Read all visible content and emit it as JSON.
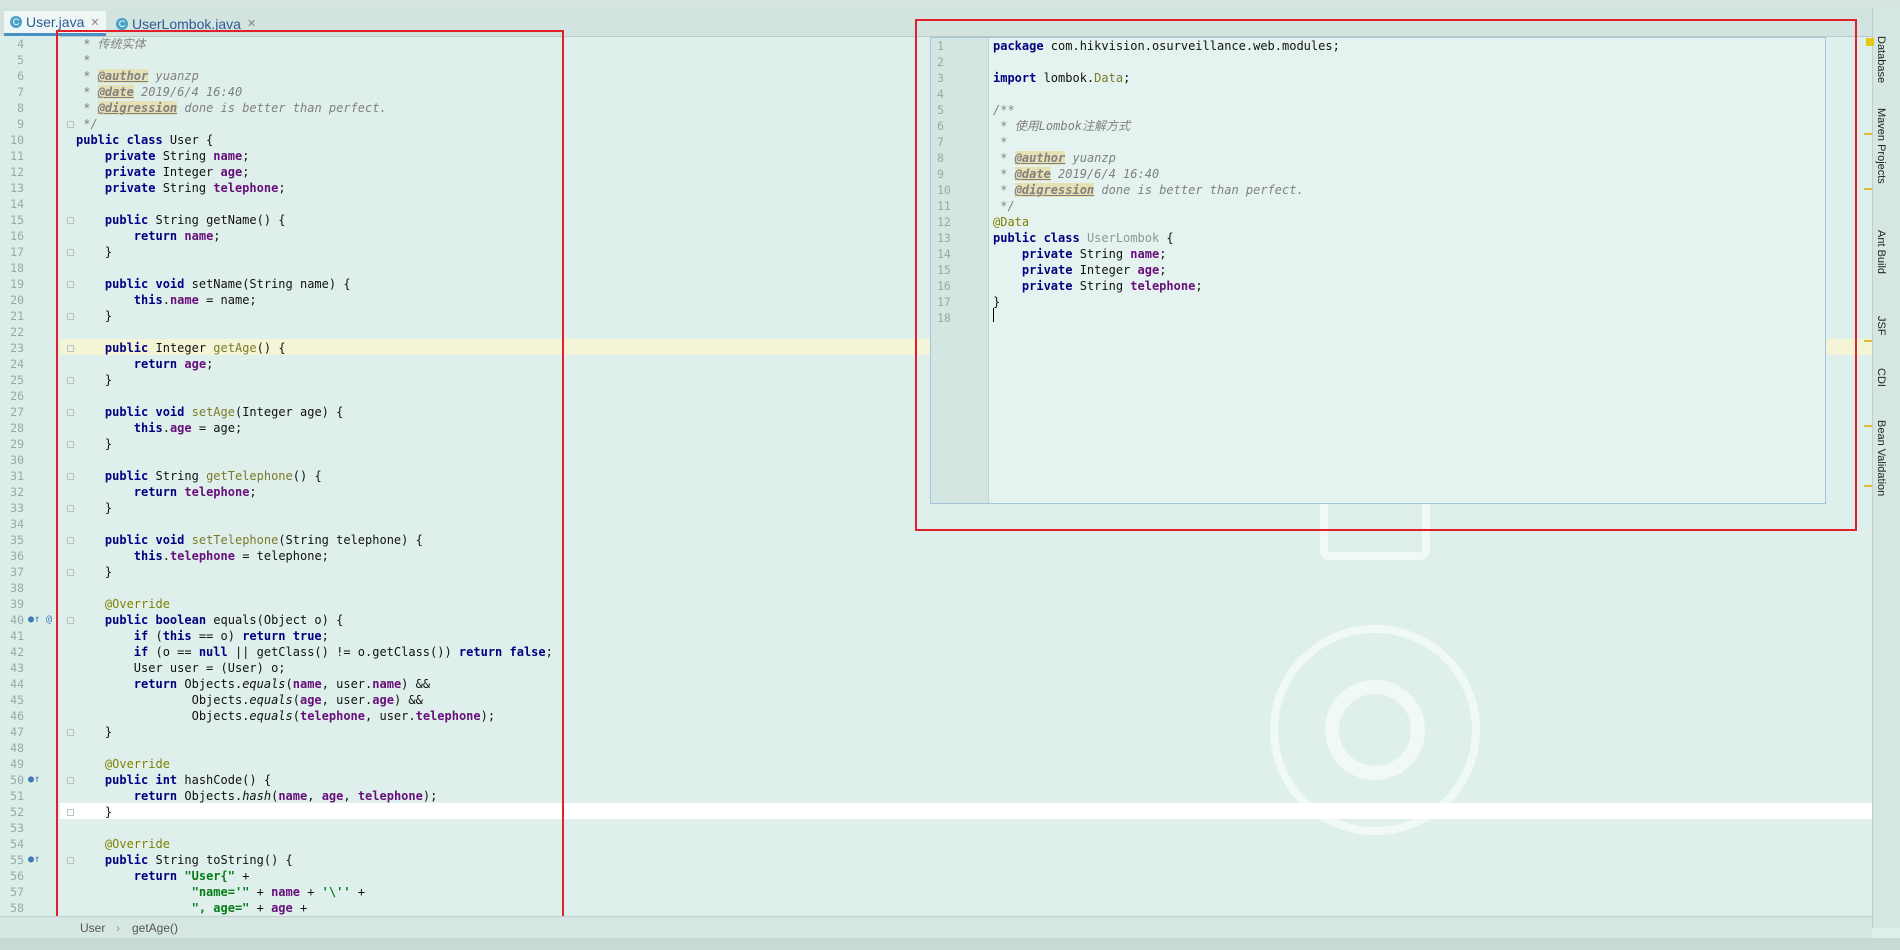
{
  "tabs": [
    {
      "label": "User.java",
      "icon": "C",
      "active": true
    },
    {
      "label": "UserLombok.java",
      "icon": "C",
      "active": false
    }
  ],
  "left_code": [
    {
      "n": "4",
      "h": "<span class=\"cm\"> * 传统实体</span>"
    },
    {
      "n": "5",
      "h": "<span class=\"cm\"> *</span>"
    },
    {
      "n": "6",
      "h": "<span class=\"cm\"> * </span><span class=\"tag\">@author</span><span class=\"cm\"> yuanzp</span>"
    },
    {
      "n": "7",
      "h": "<span class=\"cm\"> * </span><span class=\"tag\">@date</span><span class=\"cm\"> 2019/6/4 16:40</span>"
    },
    {
      "n": "8",
      "h": "<span class=\"cm\"> * </span><span class=\"tag\">@digression</span><span class=\"cm\"> done is better than perfect.</span>"
    },
    {
      "n": "9",
      "h": "<span class=\"cm\"> */</span>"
    },
    {
      "n": "10",
      "h": "<span class=\"kw\">public class</span> User {"
    },
    {
      "n": "11",
      "h": "    <span class=\"kw\">private</span> String <span class=\"fld\">name</span>;"
    },
    {
      "n": "12",
      "h": "    <span class=\"kw\">private</span> Integer <span class=\"fld\">age</span>;"
    },
    {
      "n": "13",
      "h": "    <span class=\"kw\">private</span> String <span class=\"fld\">telephone</span>;"
    },
    {
      "n": "14",
      "h": ""
    },
    {
      "n": "15",
      "h": "    <span class=\"kw\">public</span> String getName() {"
    },
    {
      "n": "16",
      "h": "        <span class=\"kw\">return</span> <span class=\"fld\">name</span>;"
    },
    {
      "n": "17",
      "h": "    }"
    },
    {
      "n": "18",
      "h": ""
    },
    {
      "n": "19",
      "h": "    <span class=\"kw\">public void</span> setName(String name) {"
    },
    {
      "n": "20",
      "h": "        <span class=\"kw\">this</span>.<span class=\"fld\">name</span> = name;"
    },
    {
      "n": "21",
      "h": "    }"
    },
    {
      "n": "22",
      "h": ""
    },
    {
      "n": "23",
      "h": "    <span class=\"kw\">public</span> Integer <span class=\"mth\">getAge</span>() {"
    },
    {
      "n": "24",
      "h": "        <span class=\"kw\">return</span> <span class=\"fld\">age</span>;"
    },
    {
      "n": "25",
      "h": "    }"
    },
    {
      "n": "26",
      "h": ""
    },
    {
      "n": "27",
      "h": "    <span class=\"kw\">public void</span> <span class=\"mth\">setAge</span>(Integer age) {"
    },
    {
      "n": "28",
      "h": "        <span class=\"kw\">this</span>.<span class=\"fld\">age</span> = age;"
    },
    {
      "n": "29",
      "h": "    }"
    },
    {
      "n": "30",
      "h": ""
    },
    {
      "n": "31",
      "h": "    <span class=\"kw\">public</span> String <span class=\"mth\">getTelephone</span>() {"
    },
    {
      "n": "32",
      "h": "        <span class=\"kw\">return</span> <span class=\"fld\">telephone</span>;"
    },
    {
      "n": "33",
      "h": "    }"
    },
    {
      "n": "34",
      "h": ""
    },
    {
      "n": "35",
      "h": "    <span class=\"kw\">public void</span> <span class=\"mth\">setTelephone</span>(String telephone) {"
    },
    {
      "n": "36",
      "h": "        <span class=\"kw\">this</span>.<span class=\"fld\">telephone</span> = telephone;"
    },
    {
      "n": "37",
      "h": "    }"
    },
    {
      "n": "38",
      "h": ""
    },
    {
      "n": "39",
      "h": "    <span class=\"ann\">@Override</span>"
    },
    {
      "n": "40",
      "h": "    <span class=\"kw\">public boolean</span> equals(Object o) {"
    },
    {
      "n": "41",
      "h": "        <span class=\"kw\">if</span> (<span class=\"kw\">this</span> == o) <span class=\"kw\">return true</span>;"
    },
    {
      "n": "42",
      "h": "        <span class=\"kw\">if</span> (o == <span class=\"kw\">null</span> || getClass() != o.getClass()) <span class=\"kw\">return false</span>;"
    },
    {
      "n": "43",
      "h": "        User user = (User) o;"
    },
    {
      "n": "44",
      "h": "        <span class=\"kw\">return</span> Objects.<span class=\"it\">equals</span>(<span class=\"fld\">name</span>, user.<span class=\"fld\">name</span>) &amp;&amp;"
    },
    {
      "n": "45",
      "h": "                Objects.<span class=\"it\">equals</span>(<span class=\"fld\">age</span>, user.<span class=\"fld\">age</span>) &amp;&amp;"
    },
    {
      "n": "46",
      "h": "                Objects.<span class=\"it\">equals</span>(<span class=\"fld\">telephone</span>, user.<span class=\"fld\">telephone</span>);"
    },
    {
      "n": "47",
      "h": "    }"
    },
    {
      "n": "48",
      "h": ""
    },
    {
      "n": "49",
      "h": "    <span class=\"ann\">@Override</span>"
    },
    {
      "n": "50",
      "h": "    <span class=\"kw\">public int</span> hashCode() {"
    },
    {
      "n": "51",
      "h": "        <span class=\"kw\">return</span> Objects.<span class=\"it\">hash</span>(<span class=\"fld\">name</span>, <span class=\"fld\">age</span>, <span class=\"fld\">telephone</span>);"
    },
    {
      "n": "52",
      "h": "    }"
    },
    {
      "n": "53",
      "h": ""
    },
    {
      "n": "54",
      "h": "    <span class=\"ann\">@Override</span>"
    },
    {
      "n": "55",
      "h": "    <span class=\"kw\">public</span> String toString() {"
    },
    {
      "n": "56",
      "h": "        <span class=\"kw\">return</span> <span class=\"str\">\"User{\"</span> +"
    },
    {
      "n": "57",
      "h": "                <span class=\"str\">\"name='\"</span> + <span class=\"fld\">name</span> + <span class=\"str\">'\\''</span> +"
    },
    {
      "n": "58",
      "h": "                <span class=\"str\">\", age=\"</span> + <span class=\"fld\">age</span> +"
    }
  ],
  "popup_code": [
    {
      "n": "1",
      "h": "<span class=\"kw\">package</span> com.hikvision.osurveillance.web.modules;"
    },
    {
      "n": "2",
      "h": ""
    },
    {
      "n": "3",
      "h": "<span class=\"kw\">import</span> lombok.<span class=\"mth\">Data</span>;"
    },
    {
      "n": "4",
      "h": ""
    },
    {
      "n": "5",
      "h": "<span class=\"cm\">/**</span>"
    },
    {
      "n": "6",
      "h": "<span class=\"cm\"> * 使用Lombok注解方式</span>"
    },
    {
      "n": "7",
      "h": "<span class=\"cm\"> *</span>"
    },
    {
      "n": "8",
      "h": "<span class=\"cm\"> * </span><span class=\"tag\">@author</span><span class=\"cm\"> yuanzp</span>"
    },
    {
      "n": "9",
      "h": "<span class=\"cm\"> * </span><span class=\"tag\">@date</span><span class=\"cm\"> 2019/6/4 16:40</span>"
    },
    {
      "n": "10",
      "h": "<span class=\"cm\"> * </span><span class=\"tag\">@digression</span><span class=\"cm\"> done is better than perfect.</span>"
    },
    {
      "n": "11",
      "h": "<span class=\"cm\"> */</span>"
    },
    {
      "n": "12",
      "h": "<span class=\"ann\">@Data</span>"
    },
    {
      "n": "13",
      "h": "<span class=\"kw\">public class</span> <span style=\"color:#8a9a97\">UserLombok</span> {"
    },
    {
      "n": "14",
      "h": "    <span class=\"kw\">private</span> String <span class=\"fld\">name</span>;"
    },
    {
      "n": "15",
      "h": "    <span class=\"kw\">private</span> Integer <span class=\"fld\">age</span>;"
    },
    {
      "n": "16",
      "h": "    <span class=\"kw\">private</span> String <span class=\"fld\">telephone</span>;"
    },
    {
      "n": "17",
      "h": "}"
    },
    {
      "n": "18",
      "h": ""
    }
  ],
  "right_tools": [
    "Database",
    "Maven Projects",
    "Ant Build",
    "JSF",
    "CDI",
    "Bean Validation"
  ],
  "breadcrumb": {
    "class": "User",
    "method": "getAge()"
  },
  "colors": {
    "highlight": "#f7f7d8",
    "redbox": "#e0202a",
    "keyword": "#000080"
  }
}
